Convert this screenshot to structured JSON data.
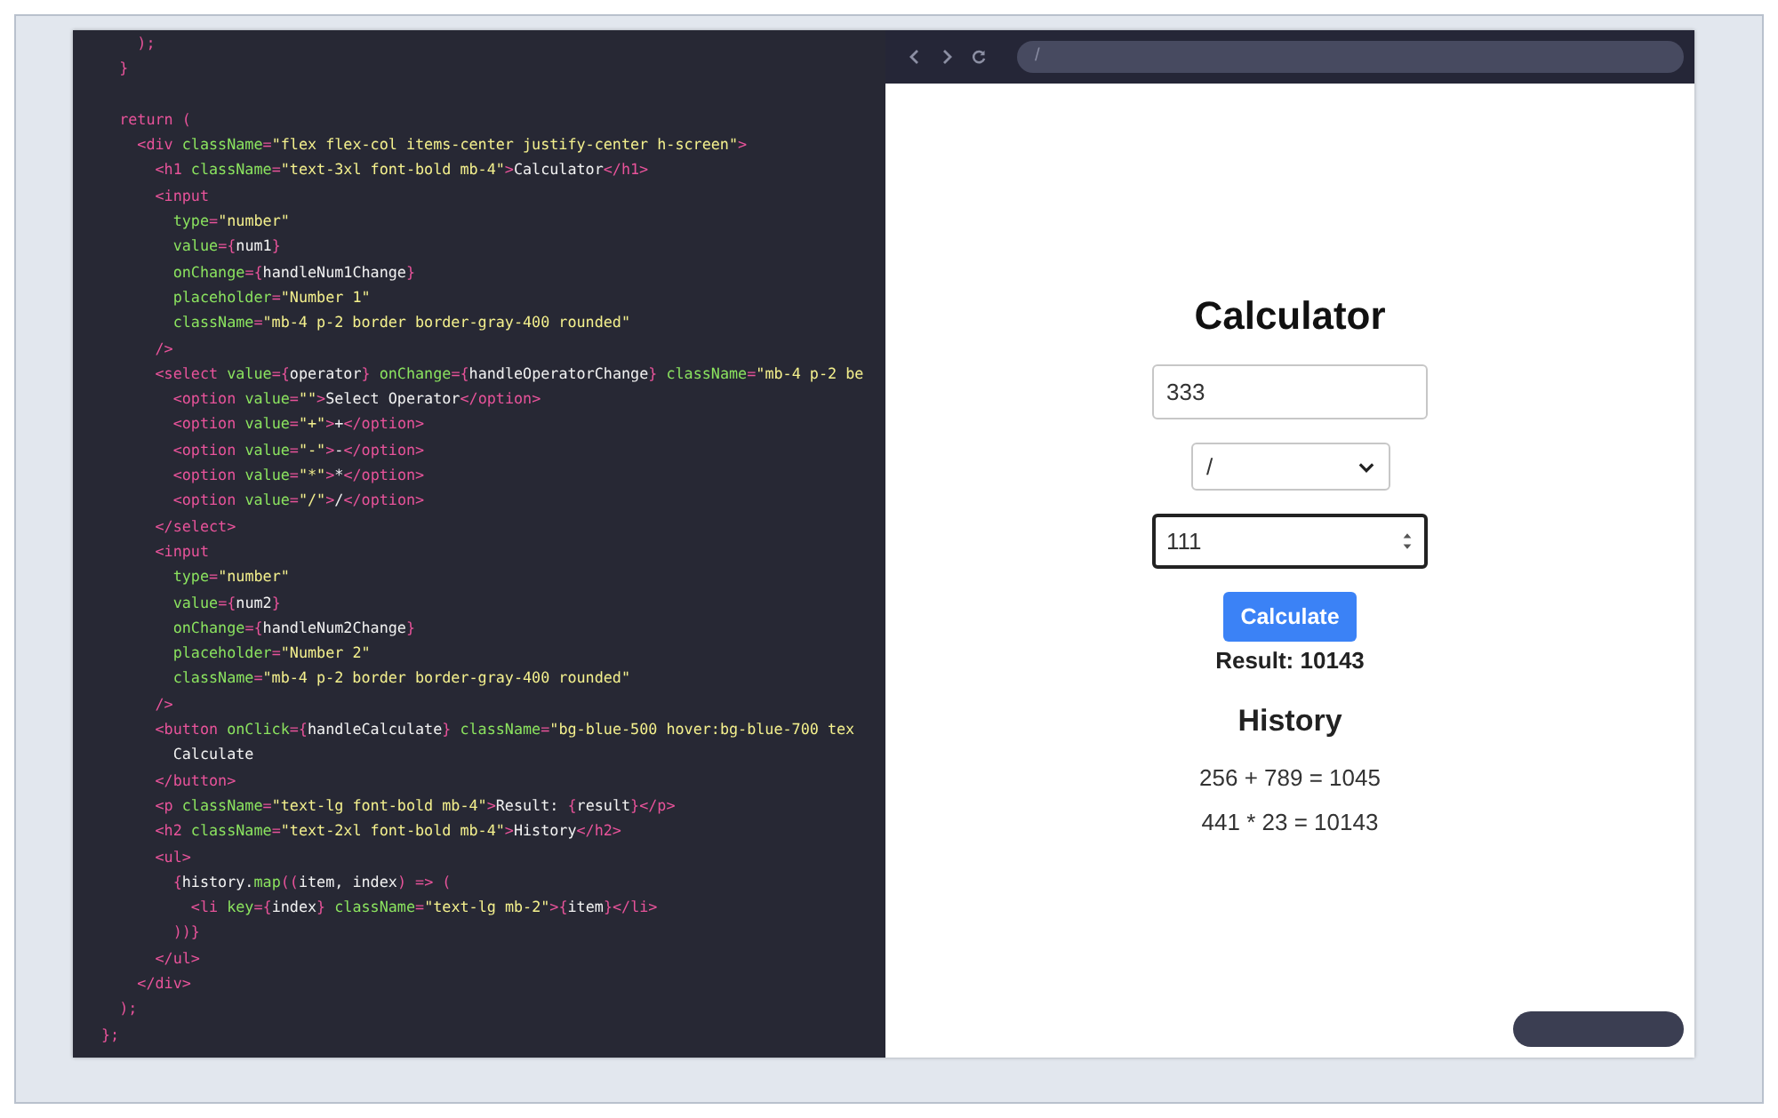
{
  "editor": {
    "lines": [
      {
        "segments": [
          {
            "kind": "tag",
            "text": "    );"
          }
        ]
      },
      {
        "segments": [
          {
            "kind": "tag",
            "text": "  }"
          }
        ]
      },
      {
        "spaced": true,
        "segments": [
          {
            "kind": "tag",
            "text": "  return ("
          }
        ]
      },
      {
        "segments": [
          {
            "kind": "tag",
            "text": "    <div "
          },
          {
            "kind": "attr",
            "text": "className"
          },
          {
            "kind": "tag",
            "text": "="
          },
          {
            "kind": "str",
            "text": "\"flex flex-col items-center justify-center h-screen\""
          },
          {
            "kind": "tag",
            "text": ">"
          }
        ]
      },
      {
        "segments": [
          {
            "kind": "tag",
            "text": "      <h1 "
          },
          {
            "kind": "attr",
            "text": "className"
          },
          {
            "kind": "tag",
            "text": "="
          },
          {
            "kind": "str",
            "text": "\"text-3xl font-bold mb-4\""
          },
          {
            "kind": "tag",
            "text": ">"
          },
          {
            "kind": "plain",
            "text": "Calculator"
          },
          {
            "kind": "tag",
            "text": "</h1>"
          }
        ]
      },
      {
        "segments": [
          {
            "kind": "tag",
            "text": "      <input"
          }
        ]
      },
      {
        "segments": [
          {
            "kind": "attr",
            "text": "        type"
          },
          {
            "kind": "tag",
            "text": "="
          },
          {
            "kind": "str",
            "text": "\"number\""
          }
        ]
      },
      {
        "segments": [
          {
            "kind": "attr",
            "text": "        value"
          },
          {
            "kind": "tag",
            "text": "={"
          },
          {
            "kind": "plain",
            "text": "num1"
          },
          {
            "kind": "tag",
            "text": "}"
          }
        ]
      },
      {
        "segments": [
          {
            "kind": "attr",
            "text": "        onChange"
          },
          {
            "kind": "tag",
            "text": "={"
          },
          {
            "kind": "plain",
            "text": "handleNum1Change"
          },
          {
            "kind": "tag",
            "text": "}"
          }
        ]
      },
      {
        "segments": [
          {
            "kind": "attr",
            "text": "        placeholder"
          },
          {
            "kind": "tag",
            "text": "="
          },
          {
            "kind": "str",
            "text": "\"Number 1\""
          }
        ]
      },
      {
        "segments": [
          {
            "kind": "attr",
            "text": "        className"
          },
          {
            "kind": "tag",
            "text": "="
          },
          {
            "kind": "str",
            "text": "\"mb-4 p-2 border border-gray-400 rounded\""
          }
        ]
      },
      {
        "segments": [
          {
            "kind": "tag",
            "text": "      />"
          }
        ]
      },
      {
        "segments": [
          {
            "kind": "tag",
            "text": "      <select "
          },
          {
            "kind": "attr",
            "text": "value"
          },
          {
            "kind": "tag",
            "text": "={"
          },
          {
            "kind": "plain",
            "text": "operator"
          },
          {
            "kind": "tag",
            "text": "} "
          },
          {
            "kind": "attr",
            "text": "onChange"
          },
          {
            "kind": "tag",
            "text": "={"
          },
          {
            "kind": "plain",
            "text": "handleOperatorChange"
          },
          {
            "kind": "tag",
            "text": "} "
          },
          {
            "kind": "attr",
            "text": "className"
          },
          {
            "kind": "tag",
            "text": "="
          },
          {
            "kind": "str",
            "text": "\"mb-4 p-2 be"
          }
        ]
      },
      {
        "segments": [
          {
            "kind": "tag",
            "text": "        <option "
          },
          {
            "kind": "attr",
            "text": "value"
          },
          {
            "kind": "tag",
            "text": "="
          },
          {
            "kind": "str",
            "text": "\"\""
          },
          {
            "kind": "tag",
            "text": ">"
          },
          {
            "kind": "plain",
            "text": "Select Operator"
          },
          {
            "kind": "tag",
            "text": "</option>"
          }
        ]
      },
      {
        "segments": [
          {
            "kind": "tag",
            "text": "        <option "
          },
          {
            "kind": "attr",
            "text": "value"
          },
          {
            "kind": "tag",
            "text": "="
          },
          {
            "kind": "str",
            "text": "\"+\""
          },
          {
            "kind": "tag",
            "text": ">"
          },
          {
            "kind": "plain",
            "text": "+"
          },
          {
            "kind": "tag",
            "text": "</option>"
          }
        ]
      },
      {
        "segments": [
          {
            "kind": "tag",
            "text": "        <option "
          },
          {
            "kind": "attr",
            "text": "value"
          },
          {
            "kind": "tag",
            "text": "="
          },
          {
            "kind": "str",
            "text": "\"-\""
          },
          {
            "kind": "tag",
            "text": ">"
          },
          {
            "kind": "plain",
            "text": "-"
          },
          {
            "kind": "tag",
            "text": "</option>"
          }
        ]
      },
      {
        "segments": [
          {
            "kind": "tag",
            "text": "        <option "
          },
          {
            "kind": "attr",
            "text": "value"
          },
          {
            "kind": "tag",
            "text": "="
          },
          {
            "kind": "str",
            "text": "\"*\""
          },
          {
            "kind": "tag",
            "text": ">"
          },
          {
            "kind": "plain",
            "text": "*"
          },
          {
            "kind": "tag",
            "text": "</option>"
          }
        ]
      },
      {
        "segments": [
          {
            "kind": "tag",
            "text": "        <option "
          },
          {
            "kind": "attr",
            "text": "value"
          },
          {
            "kind": "tag",
            "text": "="
          },
          {
            "kind": "str",
            "text": "\"/\""
          },
          {
            "kind": "tag",
            "text": ">"
          },
          {
            "kind": "plain",
            "text": "/"
          },
          {
            "kind": "tag",
            "text": "</option>"
          }
        ]
      },
      {
        "segments": [
          {
            "kind": "tag",
            "text": "      </select>"
          }
        ]
      },
      {
        "segments": [
          {
            "kind": "tag",
            "text": "      <input"
          }
        ]
      },
      {
        "segments": [
          {
            "kind": "attr",
            "text": "        type"
          },
          {
            "kind": "tag",
            "text": "="
          },
          {
            "kind": "str",
            "text": "\"number\""
          }
        ]
      },
      {
        "segments": [
          {
            "kind": "attr",
            "text": "        value"
          },
          {
            "kind": "tag",
            "text": "={"
          },
          {
            "kind": "plain",
            "text": "num2"
          },
          {
            "kind": "tag",
            "text": "}"
          }
        ]
      },
      {
        "segments": [
          {
            "kind": "attr",
            "text": "        onChange"
          },
          {
            "kind": "tag",
            "text": "={"
          },
          {
            "kind": "plain",
            "text": "handleNum2Change"
          },
          {
            "kind": "tag",
            "text": "}"
          }
        ]
      },
      {
        "segments": [
          {
            "kind": "attr",
            "text": "        placeholder"
          },
          {
            "kind": "tag",
            "text": "="
          },
          {
            "kind": "str",
            "text": "\"Number 2\""
          }
        ]
      },
      {
        "segments": [
          {
            "kind": "attr",
            "text": "        className"
          },
          {
            "kind": "tag",
            "text": "="
          },
          {
            "kind": "str",
            "text": "\"mb-4 p-2 border border-gray-400 rounded\""
          }
        ]
      },
      {
        "segments": [
          {
            "kind": "tag",
            "text": "      />"
          }
        ]
      },
      {
        "segments": [
          {
            "kind": "tag",
            "text": "      <button "
          },
          {
            "kind": "attr",
            "text": "onClick"
          },
          {
            "kind": "tag",
            "text": "={"
          },
          {
            "kind": "plain",
            "text": "handleCalculate"
          },
          {
            "kind": "tag",
            "text": "} "
          },
          {
            "kind": "attr",
            "text": "className"
          },
          {
            "kind": "tag",
            "text": "="
          },
          {
            "kind": "str",
            "text": "\"bg-blue-500 hover:bg-blue-700 tex"
          }
        ]
      },
      {
        "segments": [
          {
            "kind": "plain",
            "text": "        Calculate"
          }
        ]
      },
      {
        "segments": [
          {
            "kind": "tag",
            "text": "      </button>"
          }
        ]
      },
      {
        "segments": [
          {
            "kind": "tag",
            "text": "      <p "
          },
          {
            "kind": "attr",
            "text": "className"
          },
          {
            "kind": "tag",
            "text": "="
          },
          {
            "kind": "str",
            "text": "\"text-lg font-bold mb-4\""
          },
          {
            "kind": "tag",
            "text": ">"
          },
          {
            "kind": "plain",
            "text": "Result: "
          },
          {
            "kind": "tag",
            "text": "{"
          },
          {
            "kind": "plain",
            "text": "result"
          },
          {
            "kind": "tag",
            "text": "}</p>"
          }
        ]
      },
      {
        "segments": [
          {
            "kind": "tag",
            "text": "      <h2 "
          },
          {
            "kind": "attr",
            "text": "className"
          },
          {
            "kind": "tag",
            "text": "="
          },
          {
            "kind": "str",
            "text": "\"text-2xl font-bold mb-4\""
          },
          {
            "kind": "tag",
            "text": ">"
          },
          {
            "kind": "plain",
            "text": "History"
          },
          {
            "kind": "tag",
            "text": "</h2>"
          }
        ]
      },
      {
        "segments": [
          {
            "kind": "tag",
            "text": "      <ul>"
          }
        ]
      },
      {
        "segments": [
          {
            "kind": "tag",
            "text": "        {"
          },
          {
            "kind": "plain",
            "text": "history."
          },
          {
            "kind": "attr",
            "text": "map"
          },
          {
            "kind": "tag",
            "text": "(("
          },
          {
            "kind": "plain",
            "text": "item, index"
          },
          {
            "kind": "tag",
            "text": ") => ("
          }
        ]
      },
      {
        "segments": [
          {
            "kind": "tag",
            "text": "          <li "
          },
          {
            "kind": "attr",
            "text": "key"
          },
          {
            "kind": "tag",
            "text": "={"
          },
          {
            "kind": "plain",
            "text": "index"
          },
          {
            "kind": "tag",
            "text": "} "
          },
          {
            "kind": "attr",
            "text": "className"
          },
          {
            "kind": "tag",
            "text": "="
          },
          {
            "kind": "str",
            "text": "\"text-lg mb-2\""
          },
          {
            "kind": "tag",
            "text": ">{"
          },
          {
            "kind": "plain",
            "text": "item"
          },
          {
            "kind": "tag",
            "text": "}</li>"
          }
        ]
      },
      {
        "segments": [
          {
            "kind": "tag",
            "text": "        ))}"
          }
        ]
      },
      {
        "segments": [
          {
            "kind": "tag",
            "text": "      </ul>"
          }
        ]
      },
      {
        "segments": [
          {
            "kind": "tag",
            "text": "    </div>"
          }
        ]
      },
      {
        "segments": [
          {
            "kind": "tag",
            "text": "  );"
          }
        ]
      },
      {
        "segments": [
          {
            "kind": "tag",
            "text": "};"
          }
        ]
      }
    ]
  },
  "browser": {
    "address": "/",
    "page": {
      "title": "Calculator",
      "fields": [
        {
          "kind": "number",
          "value": "333",
          "focused": false
        },
        {
          "kind": "select",
          "value": "/"
        },
        {
          "kind": "number",
          "value": "111",
          "focused": true
        }
      ],
      "button": "Calculate",
      "result": "Result: 10143",
      "history_title": "History",
      "history": [
        "256 + 789 = 1045",
        "441 * 23 = 10143"
      ]
    }
  }
}
